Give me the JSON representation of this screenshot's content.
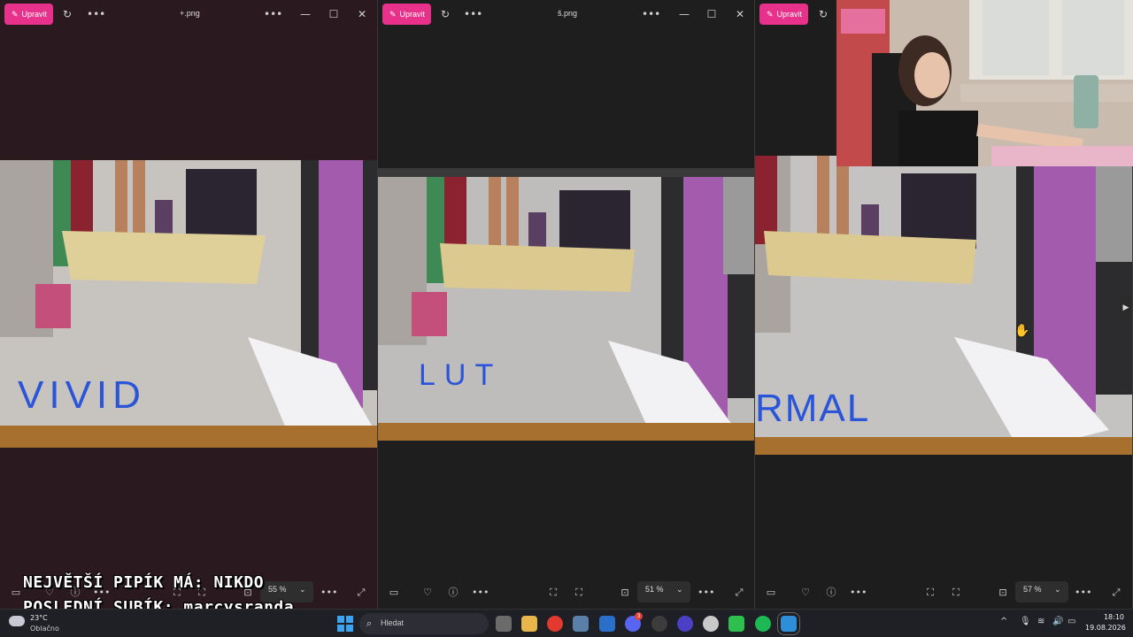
{
  "windows": [
    {
      "edit_label": "Upravit",
      "filename": "+.png",
      "zoom": "55 %",
      "drawn_text": "VIVID"
    },
    {
      "edit_label": "Upravit",
      "filename": "š.png",
      "zoom": "51 %",
      "drawn_text": "LUT"
    },
    {
      "edit_label": "Upravit",
      "filename": "",
      "zoom": "57 %",
      "drawn_text": "RMAL"
    }
  ],
  "overlay": {
    "line1": "NEJVĚTŠÍ PIPÍK MÁ: NIKDO",
    "line2": "POSLEDNÍ SUBÍK: marcysranda"
  },
  "taskbar": {
    "weather_temp": "23°C",
    "weather_desc": "Oblačno",
    "search_placeholder": "Hledat",
    "time": "18:10",
    "date": "19.08.2026",
    "badge_count": "3"
  },
  "colors": {
    "accent": "#e8318a",
    "ink": "#2a55d8"
  }
}
